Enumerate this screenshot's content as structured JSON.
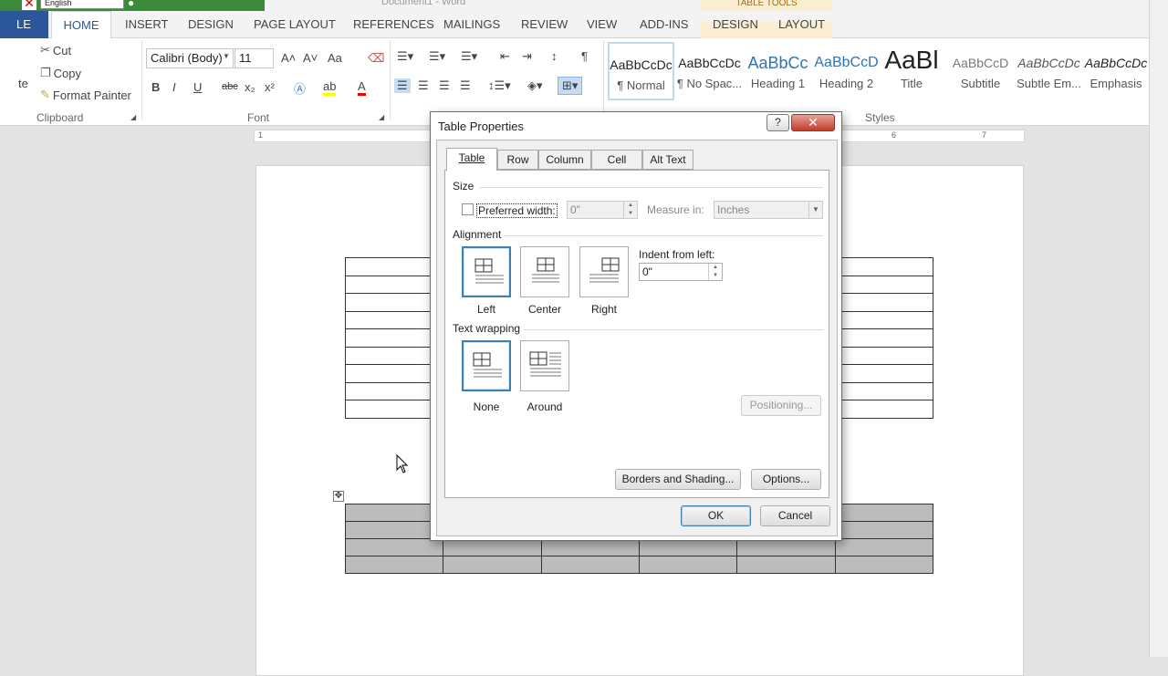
{
  "window": {
    "doc_title": "Document1 - Word",
    "context_title": "TABLE TOOLS",
    "lang": "English"
  },
  "tabs": {
    "file": "LE",
    "home": "HOME",
    "insert": "INSERT",
    "design": "DESIGN",
    "page_layout": "PAGE LAYOUT",
    "references": "REFERENCES",
    "mailings": "MAILINGS",
    "review": "REVIEW",
    "view": "VIEW",
    "addins": "ADD-INS",
    "tt_design": "DESIGN",
    "tt_layout": "LAYOUT"
  },
  "clipboard": {
    "paste": "te",
    "cut": "Cut",
    "copy": "Copy",
    "format_painter": "Format Painter",
    "label": "Clipboard"
  },
  "font": {
    "name": "Calibri (Body)",
    "size": "11",
    "label": "Font",
    "bold": "B",
    "italic": "I",
    "underline": "U",
    "strike": "abc",
    "sub": "x₂",
    "sup": "x²",
    "case": "Aa"
  },
  "styles": {
    "label": "Styles",
    "items": [
      {
        "preview": "AaBbCcDc",
        "name": "¶ Normal"
      },
      {
        "preview": "AaBbCcDc",
        "name": "¶ No Spac..."
      },
      {
        "preview": "AaBbCc",
        "name": "Heading 1"
      },
      {
        "preview": "AaBbCcD",
        "name": "Heading 2"
      },
      {
        "preview": "AaBl",
        "name": "Title"
      },
      {
        "preview": "AaBbCcD",
        "name": "Subtitle"
      },
      {
        "preview": "AaBbCcDc",
        "name": "Subtle Em..."
      },
      {
        "preview": "AaBbCcDc",
        "name": "Emphasis"
      }
    ]
  },
  "ruler": {
    "left": "1",
    "r6": "6",
    "r7": "7"
  },
  "dialog": {
    "title": "Table Properties",
    "help": "?",
    "close": "✕",
    "tabs": [
      "Table",
      "Row",
      "Column",
      "Cell",
      "Alt Text"
    ],
    "size": {
      "label": "Size",
      "preferred_width": "Preferred width:",
      "width_value": "0\"",
      "measure_in": "Measure in:",
      "measure_value": "Inches"
    },
    "alignment": {
      "label": "Alignment",
      "left": "Left",
      "center": "Center",
      "right": "Right",
      "indent_label": "Indent from left:",
      "indent_value": "0\""
    },
    "wrapping": {
      "label": "Text wrapping",
      "none": "None",
      "around": "Around",
      "positioning": "Positioning..."
    },
    "borders": "Borders and Shading...",
    "options": "Options...",
    "ok": "OK",
    "cancel": "Cancel"
  },
  "colors": {
    "accent": "#2b579a",
    "context": "#fbeed0",
    "shade": "#bcbcbc"
  }
}
